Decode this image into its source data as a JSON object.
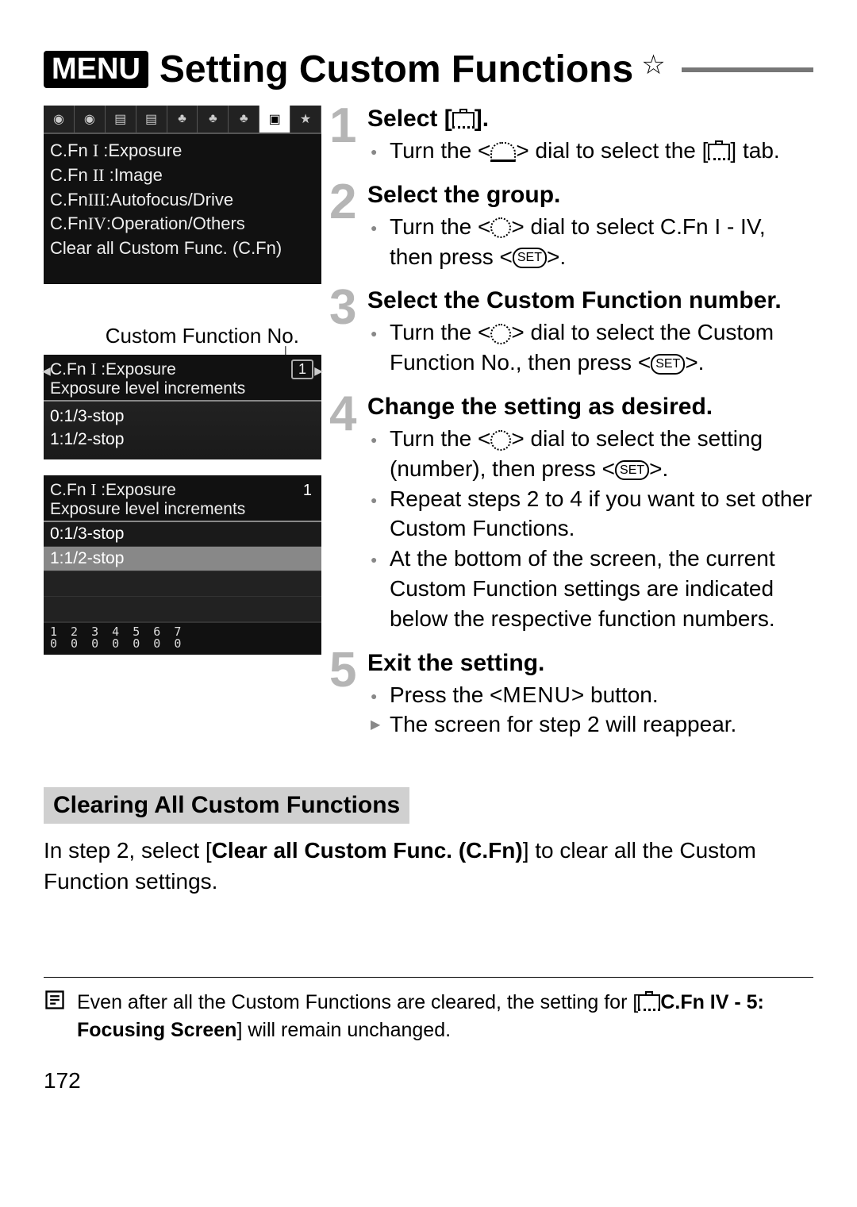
{
  "header": {
    "menu_label": "MENU",
    "title": "Setting Custom Functions",
    "star": "☆"
  },
  "screen1": {
    "tabs": [
      "◉",
      "◉",
      "▤",
      "▤",
      "♣",
      "♣",
      "♣",
      "▣",
      "★"
    ],
    "lines": [
      "C.Fn I :Exposure",
      "C.Fn II :Image",
      "C.Fn III:Autofocus/Drive",
      "C.Fn IV:Operation/Others",
      "Clear all Custom Func. (C.Fn)"
    ]
  },
  "screen2": {
    "label_above": "Custom Function No.",
    "hdr_line1": "C.Fn I :Exposure",
    "hdr_line2": "Exposure level increments",
    "number": "1",
    "opts": [
      "0:1/3-stop",
      "1:1/2-stop"
    ]
  },
  "screen3": {
    "hdr_line1": "C.Fn I :Exposure",
    "hdr_line2": "Exposure level increments",
    "number": "1",
    "opts": [
      "0:1/3-stop",
      "1:1/2-stop"
    ],
    "footer_top": "1 2 3 4 5 6 7",
    "footer_bot": "0 0 0 0 0 0 0"
  },
  "steps": {
    "s1": {
      "title_a": "Select [",
      "title_b": "].",
      "b1a": "Turn the <",
      "b1b": "> dial to select the [",
      "b1c": "] tab."
    },
    "s2": {
      "title": "Select the group.",
      "b1a": "Turn the <",
      "b1b": "> dial to select C.Fn I - IV, then press <",
      "b1c": ">."
    },
    "s3": {
      "title": "Select the Custom Function number.",
      "b1a": "Turn the <",
      "b1b": "> dial to select the Custom Function No., then press <",
      "b1c": ">."
    },
    "s4": {
      "title": "Change the setting as desired.",
      "b1a": "Turn the <",
      "b1b": "> dial to select the setting (number), then press <",
      "b1c": ">.",
      "b2": "Repeat steps 2 to 4 if you want to set other Custom Functions.",
      "b3": "At the bottom of the screen, the current Custom Function settings are indicated below the respective function numbers."
    },
    "s5": {
      "title": "Exit the setting.",
      "b1a": "Press the <",
      "b1b": "> button.",
      "menu_word": "MENU",
      "b2": "The screen for step 2 will reappear."
    }
  },
  "clearing": {
    "heading": "Clearing All Custom Functions",
    "text_a": "In step 2, select [",
    "text_bold": "Clear all Custom Func. (C.Fn)",
    "text_b": "] to clear all the Custom Function settings."
  },
  "note": {
    "text_a": "Even after all the Custom Functions are cleared, the setting for [",
    "text_bold": "C.Fn IV - 5: Focusing Screen",
    "text_b": "] will remain unchanged."
  },
  "page_number": "172"
}
